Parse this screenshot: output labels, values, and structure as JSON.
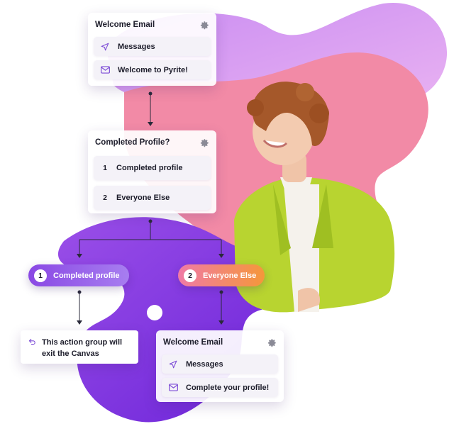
{
  "colors": {
    "purple_deep": "#7a2fe0",
    "purple_light": "#d9a6f5",
    "pink": "#f28aa6",
    "pill_purple": "#8f4fe6",
    "pill_orange": "#f5913e",
    "jacket": "#b8d430"
  },
  "icons": {
    "gear": "gear-icon",
    "send": "send-icon",
    "email": "email-icon",
    "undo": "undo-icon"
  },
  "top_card": {
    "title": "Welcome Email",
    "rows": [
      {
        "icon": "send-icon",
        "label": "Messages"
      },
      {
        "icon": "email-icon",
        "label": "Welcome to Pyrite!"
      }
    ]
  },
  "decision_card": {
    "title": "Completed Profile?",
    "rows": [
      {
        "num": "1",
        "label": "Completed profile"
      },
      {
        "num": "2",
        "label": "Everyone Else"
      }
    ]
  },
  "branches": [
    {
      "num": "1",
      "label": "Completed profile"
    },
    {
      "num": "2",
      "label": "Everyone Else"
    }
  ],
  "exit_card": {
    "label": "This action group will exit the Canvas"
  },
  "bottom_card": {
    "title": "Welcome Email",
    "rows": [
      {
        "icon": "send-icon",
        "label": "Messages"
      },
      {
        "icon": "email-icon",
        "label": "Complete your profile!"
      }
    ]
  }
}
